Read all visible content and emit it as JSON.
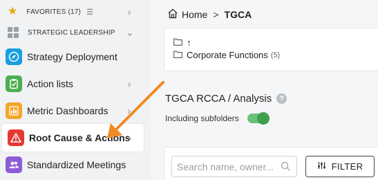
{
  "sidebar": {
    "favorites": {
      "label": "FAVORITES (17)"
    },
    "strategic": {
      "label": "STRATEGIC LEADERSHIP"
    },
    "items": [
      {
        "label": "Strategy Deployment",
        "icon": "compass-icon",
        "color": "#1a9ee0"
      },
      {
        "label": "Action lists",
        "icon": "clipboard-check-icon",
        "color": "#4caf50"
      },
      {
        "label": "Metric Dashboards",
        "icon": "bar-chart-icon",
        "color": "#f4a52a"
      },
      {
        "label": "Root Cause & Actions",
        "icon": "warning-icon",
        "color": "#e53935"
      },
      {
        "label": "Standardized Meetings",
        "icon": "people-icon",
        "color": "#8e5bd6"
      }
    ]
  },
  "breadcrumb": {
    "home": "Home",
    "separator": ">",
    "current": "TGCA"
  },
  "folders": {
    "up_label": "↑",
    "items": [
      {
        "label": "Corporate Functions",
        "count": "(5)"
      }
    ]
  },
  "section": {
    "title": "TGCA RCCA / Analysis",
    "help": "?",
    "subfolders_label": "Including subfolders",
    "subfolders_on": true
  },
  "filter": {
    "search_placeholder": "Search name, owner...",
    "search_value": "",
    "filter_label": "FILTER"
  },
  "colors": {
    "accent_green": "#3ea04f",
    "annotation_arrow": "#f08a24"
  }
}
